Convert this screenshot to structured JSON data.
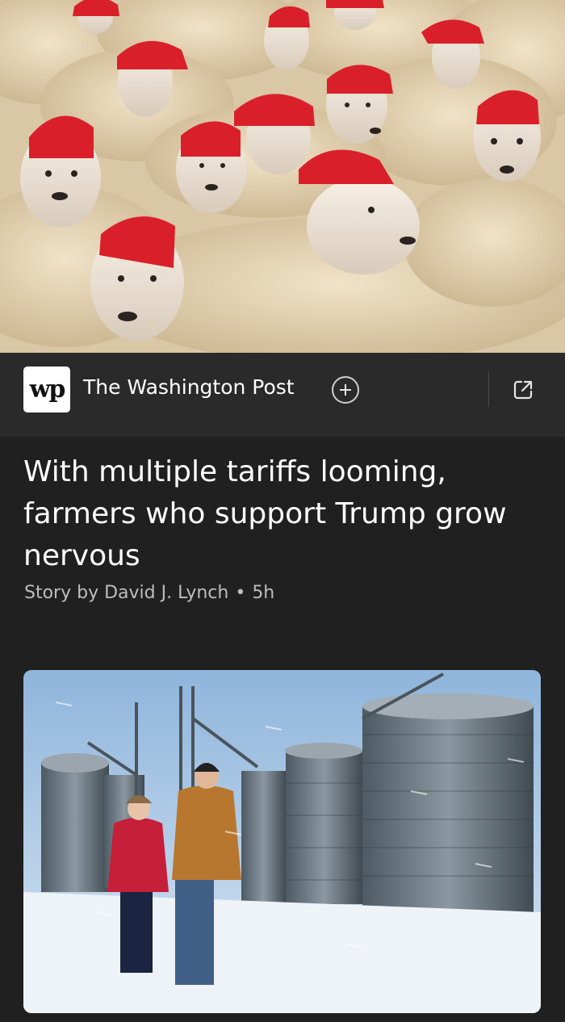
{
  "hero_image": {
    "description_icon": "sheep-in-red-caps-photo"
  },
  "publisher": {
    "logo_text": "wp",
    "name": "The Washington Post"
  },
  "article": {
    "headline": "With multiple tariffs looming, farmers who support Trump grow nervous",
    "byline_prefix": "Story by",
    "author": "David J. Lynch",
    "separator": "•",
    "age": "5h"
  },
  "colors": {
    "background": "#202020",
    "bar": "#2a2a2a",
    "cap_red": "#d9202a",
    "byline": "#bdbdbd"
  }
}
